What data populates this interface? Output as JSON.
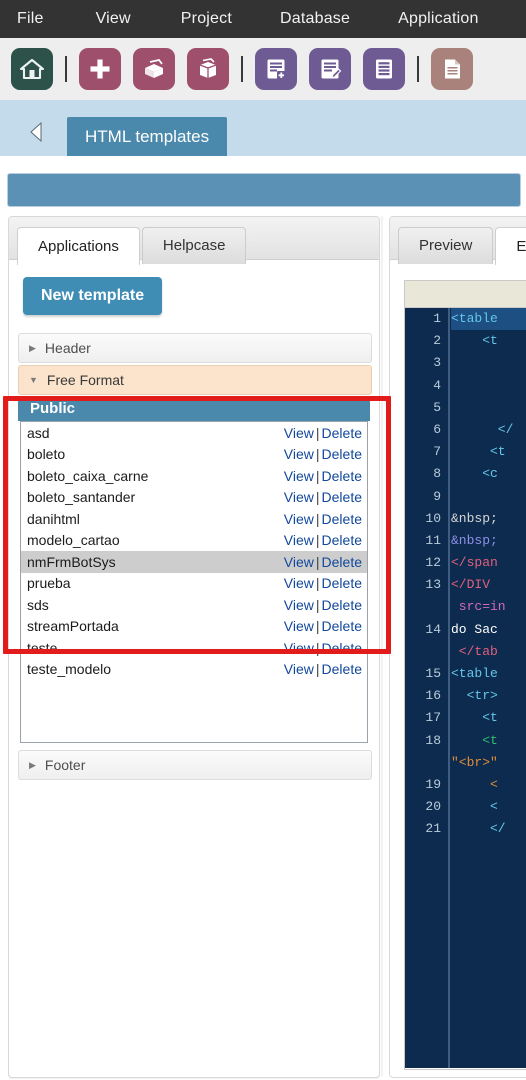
{
  "menubar": {
    "items": [
      {
        "label": "File"
      },
      {
        "label": "View"
      },
      {
        "label": "Project"
      },
      {
        "label": "Database"
      },
      {
        "label": "Application"
      }
    ]
  },
  "toolbar": {
    "buttons": [
      {
        "name": "home-icon",
        "title": "Home",
        "color": "#2c5249"
      },
      {
        "name": "separator-1"
      },
      {
        "name": "new-icon",
        "title": "New",
        "color": "#9e4f6c"
      },
      {
        "name": "open-box-icon",
        "title": "Open",
        "color": "#9e4f6c"
      },
      {
        "name": "package-icon",
        "title": "Package",
        "color": "#9e4f6c"
      },
      {
        "name": "separator-2"
      },
      {
        "name": "new-form-icon",
        "title": "New form",
        "color": "#6e5b94"
      },
      {
        "name": "edit-form-icon",
        "title": "Edit form",
        "color": "#6e5b94"
      },
      {
        "name": "grid-icon",
        "title": "Grid",
        "color": "#6e5b94"
      },
      {
        "name": "separator-3"
      },
      {
        "name": "document-icon",
        "title": "Document",
        "color": "#a9827c"
      }
    ]
  },
  "titlestrip": {
    "back_icon": "back-arrow-icon",
    "tab_title": "HTML templates"
  },
  "left_panel": {
    "tabs": [
      {
        "label": "Applications",
        "active": true
      },
      {
        "label": "Helpcase",
        "active": false
      }
    ],
    "new_template_button": "New template",
    "sections": [
      {
        "label": "Header",
        "open": false
      },
      {
        "label": "Free Format",
        "open": true
      },
      {
        "label": "Footer",
        "open": false
      }
    ],
    "group_header": "Public",
    "actions": {
      "view": "View",
      "delete": "Delete",
      "separator": "|"
    },
    "templates": [
      {
        "name": "asd",
        "selected": false
      },
      {
        "name": "boleto",
        "selected": false
      },
      {
        "name": "boleto_caixa_carne",
        "selected": false
      },
      {
        "name": "boleto_santander",
        "selected": false
      },
      {
        "name": "danihtml",
        "selected": false
      },
      {
        "name": "modelo_cartao",
        "selected": false
      },
      {
        "name": "nmFrmBotSys",
        "selected": true
      },
      {
        "name": "prueba",
        "selected": false
      },
      {
        "name": "sds",
        "selected": false
      },
      {
        "name": "streamPortada",
        "selected": false
      },
      {
        "name": "teste",
        "selected": false
      },
      {
        "name": "teste_modelo",
        "selected": false
      }
    ]
  },
  "right_panel": {
    "tabs": [
      {
        "label": "Preview",
        "active": false
      },
      {
        "label": "Ed",
        "active": true
      }
    ]
  },
  "editor": {
    "line_numbers": [
      "1",
      "2",
      "3",
      "4",
      "5",
      "6",
      "7",
      "8",
      "9",
      "10",
      "11",
      "12",
      "13",
      "",
      "14",
      "",
      "15",
      "16",
      "17",
      "18",
      "",
      "19",
      "20",
      "21",
      ""
    ],
    "lines": [
      {
        "num": "1",
        "text": "<table",
        "selected": true
      },
      {
        "num": "2",
        "text": "    <t",
        "selected": false
      },
      {
        "num": "3",
        "text": "",
        "selected": false
      },
      {
        "num": "4",
        "text": "",
        "selected": false
      },
      {
        "num": "5",
        "text": "",
        "selected": false
      },
      {
        "num": "6",
        "text": "      </",
        "selected": false
      },
      {
        "num": "7",
        "text": "     <t",
        "selected": false
      },
      {
        "num": "8",
        "text": "    <c",
        "selected": false
      },
      {
        "num": "9",
        "text": "",
        "selected": false
      },
      {
        "num": "10",
        "text": "&nbsp;",
        "selected": false
      },
      {
        "num": "11",
        "text": "&nbsp;",
        "selected": false
      },
      {
        "num": "12",
        "text": "</span",
        "selected": false
      },
      {
        "num": "13",
        "text": "</DIV",
        "selected": false
      },
      {
        "num": "",
        "text": " src=in",
        "selected": false
      },
      {
        "num": "14",
        "text": "do Sac",
        "selected": false
      },
      {
        "num": "",
        "text": " </tab",
        "selected": false
      },
      {
        "num": "15",
        "text": "<table",
        "selected": false
      },
      {
        "num": "16",
        "text": "  <tr>",
        "selected": false
      },
      {
        "num": "17",
        "text": "    <t",
        "selected": false
      },
      {
        "num": "18",
        "text": "    <t",
        "selected": false
      },
      {
        "num": "",
        "text": "\"<br>\"",
        "selected": false
      },
      {
        "num": "19",
        "text": "     <",
        "selected": false
      },
      {
        "num": "20",
        "text": "     <",
        "selected": false
      },
      {
        "num": "21",
        "text": "     </",
        "selected": false
      }
    ]
  },
  "colors": {
    "menubar_bg": "#333333",
    "toolbar_bg": "#eeeeee",
    "titlestrip_bg": "#c3dbeb",
    "tab_active_bg": "#4a89ab",
    "blue_bar": "#5b91b5",
    "accent_button": "#3f8db5",
    "accordion_open_bg": "#fbe4cb",
    "selection_row": "#cdcdcd",
    "annotation_red": "#e21b1b",
    "code_bg": "#0d2b4e",
    "link_blue": "#12489b"
  }
}
